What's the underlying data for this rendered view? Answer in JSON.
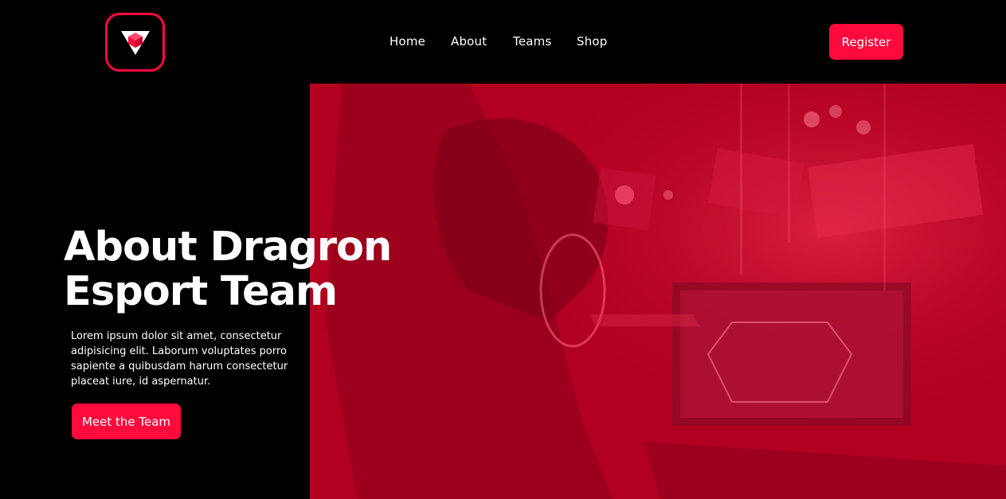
{
  "brand": {
    "logo_icon": "triangle-cube-logo-icon",
    "accent_color": "#ff0a3c"
  },
  "nav": {
    "items": [
      {
        "label": "Home"
      },
      {
        "label": "About"
      },
      {
        "label": "Teams"
      },
      {
        "label": "Shop"
      }
    ],
    "register_label": "Register"
  },
  "hero": {
    "title_line1": "About Dragron",
    "title_line2": "Esport Team",
    "description": "Lorem ipsum dolor sit amet, consectetur adipisicing elit. Laborum voluptates porro sapiente a quibusdam harum consectetur placeat iure, id aspernatur.",
    "cta_label": "Meet the Team",
    "image_overlay_color": "#b10020"
  }
}
